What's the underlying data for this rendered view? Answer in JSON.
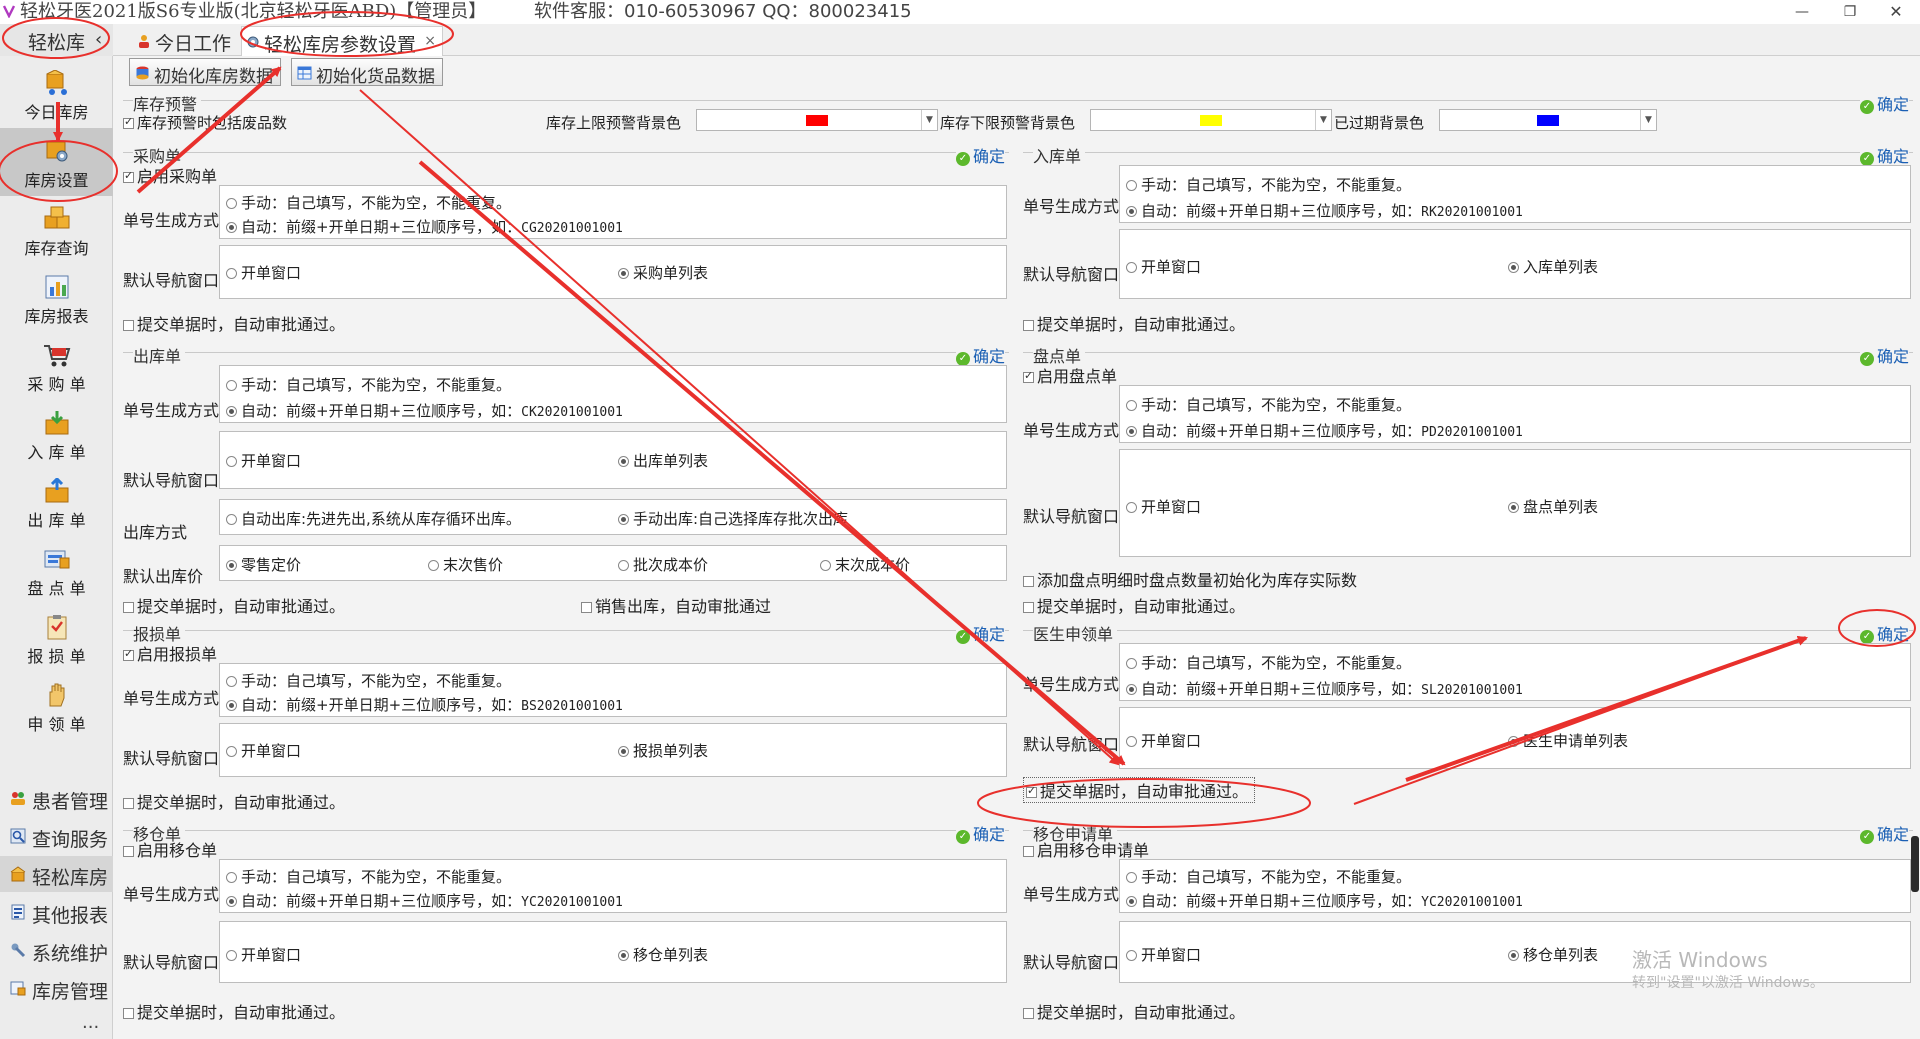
{
  "titlebar": {
    "title": "轻松牙医2021版S6专业版(北京轻松牙医ABD)【管理员】",
    "service": "软件客服：010-60530967 QQ：800023415"
  },
  "sidebar": {
    "header": "轻松库",
    "items": [
      {
        "label": "今日库房",
        "icon": "package-cart-icon"
      },
      {
        "label": "库房设置",
        "icon": "settings-box-icon"
      },
      {
        "label": "库存查询",
        "icon": "boxes-icon"
      },
      {
        "label": "库房报表",
        "icon": "report-chart-icon"
      },
      {
        "label": "采 购 单",
        "icon": "cart-icon"
      },
      {
        "label": "入 库 单",
        "icon": "inbox-in-icon"
      },
      {
        "label": "出 库 单",
        "icon": "inbox-out-icon"
      },
      {
        "label": "盘 点 单",
        "icon": "inventory-count-icon"
      },
      {
        "label": "报 损 单",
        "icon": "clipboard-icon"
      },
      {
        "label": "申 领 单",
        "icon": "hand-icon"
      }
    ],
    "menus": [
      {
        "label": "患者管理",
        "icon": "people-icon"
      },
      {
        "label": "查询服务",
        "icon": "search-icon"
      },
      {
        "label": "轻松库房",
        "icon": "warehouse-icon"
      },
      {
        "label": "其他报表",
        "icon": "report-icon"
      },
      {
        "label": "系统维护",
        "icon": "wrench-icon"
      },
      {
        "label": "库房管理",
        "icon": "warehouse-manage-icon"
      }
    ],
    "more": "..."
  },
  "tabs": [
    {
      "label": "今日工作"
    },
    {
      "label": "轻松库房参数设置"
    }
  ],
  "toolbar": {
    "init_warehouse": "初始化库房数据",
    "init_goods": "初始化货品数据"
  },
  "ok_label": "确定",
  "colors": {
    "upper": "#ff0000",
    "lower": "#ffff00",
    "expired": "#0000ff",
    "annotation": "#e8302c",
    "ok_icon": "#5cb82c"
  },
  "warning": {
    "title": "库存预警",
    "include_scrap": "库存预警时包括废品数",
    "upper_label": "库存上限预警背景色",
    "lower_label": "库存下限预警背景色",
    "expired_label": "已过期背景色"
  },
  "common": {
    "number_mode": "单号生成方式",
    "nav_window": "默认导航窗口",
    "manual": "手动：自己填写，不能为空，不能重复。",
    "auto_prefix": "自动：前缀+开单日期+三位顺序号，如：",
    "open_window": "开单窗口",
    "auto_approve": "提交单据时，自动审批通过。"
  },
  "purchase": {
    "title": "采购单",
    "enable": "启用采购单",
    "example": "CG20201001001",
    "list": "采购单列表"
  },
  "stock_in": {
    "title": "入库单",
    "example": "RK20201001001",
    "list": "入库单列表"
  },
  "stock_out": {
    "title": "出库单",
    "example": "CK20201001001",
    "list": "出库单列表",
    "method_label": "出库方式",
    "method_auto": "自动出库:先进先出,系统从库存循环出库。",
    "method_manual": "手动出库:自己选择库存批次出库",
    "price_label": "默认出库价",
    "prices": [
      "零售定价",
      "末次售价",
      "批次成本价",
      "末次成本价"
    ],
    "sale_approve": "销售出库，自动审批通过"
  },
  "inventory": {
    "title": "盘点单",
    "enable": "启用盘点单",
    "example": "PD20201001001",
    "list": "盘点单列表",
    "init_qty": "添加盘点明细时盘点数量初始化为库存实际数"
  },
  "loss": {
    "title": "报损单",
    "enable": "启用报损单",
    "example": "BS20201001001",
    "list": "报损单列表"
  },
  "doctor": {
    "title": "医生申领单",
    "example": "SL20201001001",
    "list": "医生申请单列表"
  },
  "transfer": {
    "title": "移仓单",
    "enable": "启用移仓单",
    "example": "YC20201001001",
    "list": "移仓单列表"
  },
  "transfer_req": {
    "title": "移仓申请单",
    "enable": "启用移仓申请单",
    "example": "YC20201001001",
    "list": "移仓单列表"
  },
  "watermark": {
    "line1": "激活 Windows",
    "line2": "转到\"设置\"以激活 Windows。"
  }
}
